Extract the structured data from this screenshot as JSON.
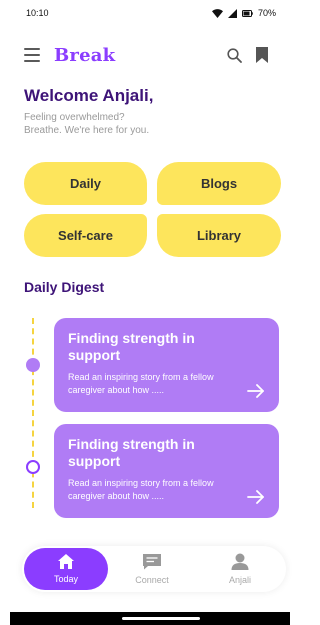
{
  "status_bar": {
    "time": "10:10",
    "battery": "70%"
  },
  "header": {
    "brand": "Break"
  },
  "welcome": {
    "title": "Welcome Anjali,",
    "line1": "Feeling overwhelmed?",
    "line2": "Breathe. We're here for you."
  },
  "categories": [
    "Daily",
    "Blogs",
    "Self-care",
    "Library"
  ],
  "daily_digest": {
    "title": "Daily Digest",
    "cards": [
      {
        "title": "Finding strength in support",
        "description": "Read an inspiring story from a fellow caregiver about how ....."
      },
      {
        "title": "Finding strength in support",
        "description": "Read an inspiring story from a fellow caregiver about how ....."
      }
    ]
  },
  "bottom_nav": {
    "items": [
      {
        "label": "Today",
        "icon": "home-icon",
        "active": true
      },
      {
        "label": "Connect",
        "icon": "chat-icon",
        "active": false
      },
      {
        "label": "Anjali",
        "icon": "person-icon",
        "active": false
      }
    ]
  },
  "colors": {
    "accent": "#8b3dff",
    "card": "#b07cf5",
    "category": "#fde55c",
    "heading": "#3e1478",
    "muted": "#9a9a9a"
  }
}
